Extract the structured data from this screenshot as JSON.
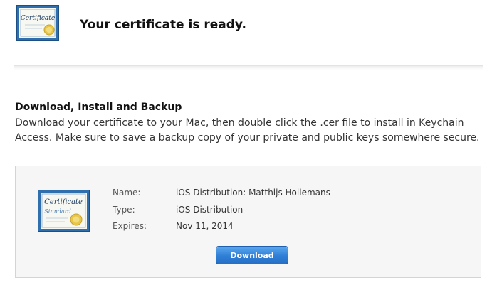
{
  "header": {
    "title": "Your certificate is ready.",
    "icon": "certificate-icon"
  },
  "section": {
    "heading": "Download, Install and Backup",
    "description": "Download your certificate to your Mac, then double click the .cer file to install in Keychain Access. Make sure to save a backup copy of your private and public keys somewhere secure."
  },
  "certificate": {
    "icon": "certificate-standard-icon",
    "fields": [
      {
        "label": "Name:",
        "value": "iOS Distribution: Matthijs Hollemans"
      },
      {
        "label": "Type:",
        "value": "iOS Distribution"
      },
      {
        "label": "Expires:",
        "value": "Nov 11, 2014"
      }
    ],
    "download_label": "Download"
  },
  "colors": {
    "button_blue": "#2f7fd6",
    "card_background": "#f6f6f6",
    "certificate_frame": "#2f6fae",
    "seal_gold": "#e8c64a"
  }
}
